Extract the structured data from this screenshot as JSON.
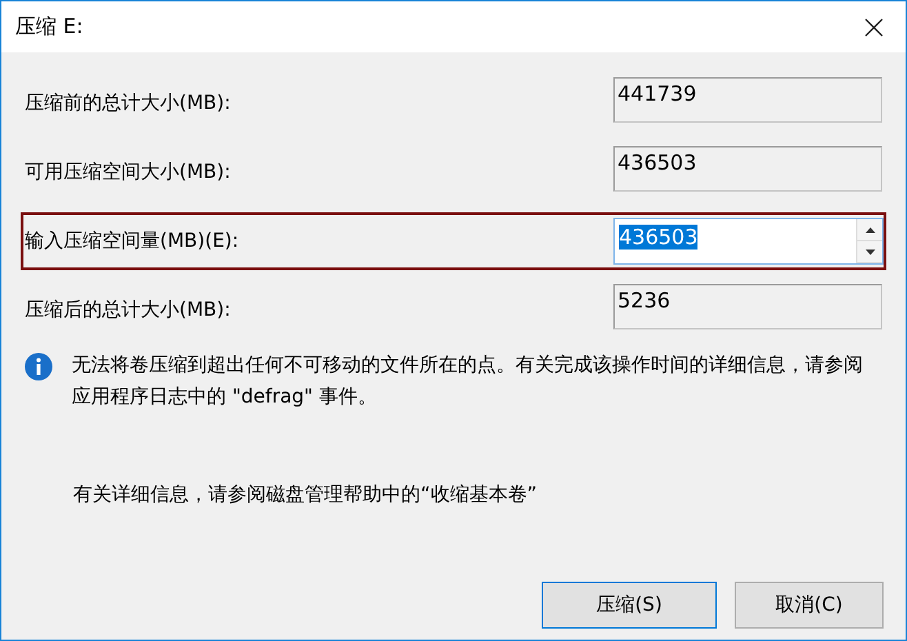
{
  "window": {
    "title": "压缩 E:"
  },
  "fields": [
    {
      "label": "压缩前的总计大小(MB):",
      "value": "441739",
      "kind": "readonly",
      "focused": false
    },
    {
      "label": "可用压缩空间大小(MB):",
      "value": "436503",
      "kind": "readonly",
      "focused": false
    },
    {
      "label": "输入压缩空间量(MB)(E):",
      "value": "436503",
      "kind": "spin",
      "focused": true
    },
    {
      "label": "压缩后的总计大小(MB):",
      "value": "5236",
      "kind": "readonly",
      "focused": false
    }
  ],
  "info": {
    "message": "无法将卷压缩到超出任何不可移动的文件所在的点。有关完成该操作时间的详细信息，请参阅应用程序日志中的 \"defrag\" 事件。"
  },
  "help": "有关详细信息，请参阅磁盘管理帮助中的“收缩基本卷”",
  "buttons": [
    {
      "label": "压缩(S)",
      "default": true
    },
    {
      "label": "取消(C)",
      "default": false
    }
  ]
}
